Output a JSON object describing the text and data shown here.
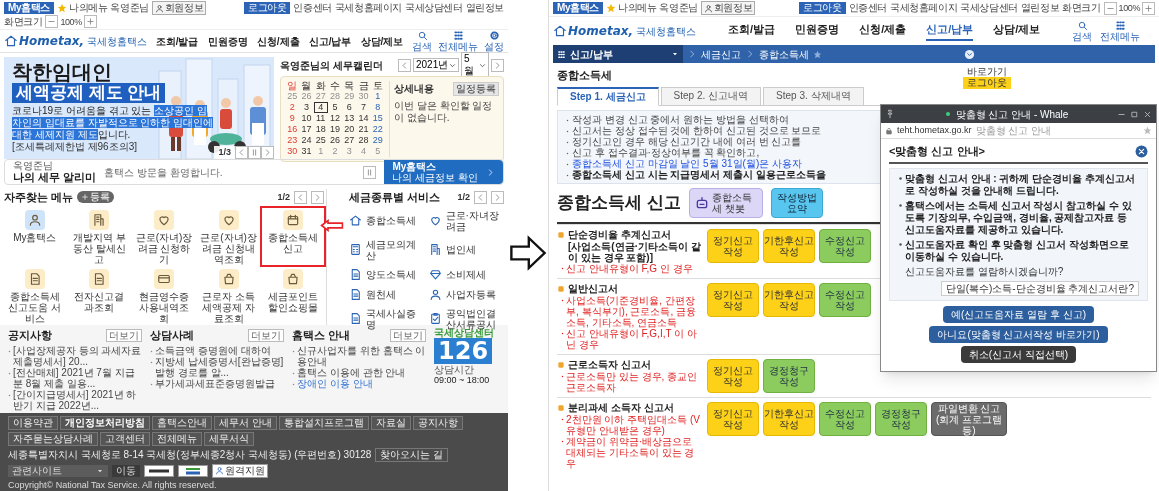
{
  "left": {
    "topbar": {
      "my": "My홈택스",
      "mymenu": "나의메뉴",
      "user": "옥영준님",
      "member": "회원정보",
      "links": [
        {
          "label": "로그아웃",
          "kind": "button"
        },
        {
          "label": "인증센터",
          "kind": "link"
        },
        {
          "label": "국세청홈페이지",
          "kind": "link"
        },
        {
          "label": "국세상담센터",
          "kind": "link"
        },
        {
          "label": "열린정보",
          "kind": "link"
        },
        {
          "label": "화면크기",
          "kind": "link"
        }
      ],
      "zoom": "100%"
    },
    "nav": {
      "logo": "Hometax,",
      "logo_sub": "국세청홈택스",
      "items": [
        "조회/발급",
        "민원증명",
        "신청/제출",
        "신고/납부",
        "상담/제보"
      ],
      "tools": [
        "검색",
        "전체메뉴",
        "설정"
      ]
    },
    "banner": {
      "title1": "착한임대인",
      "title2": "세액공제 제도 안내",
      "text_before": "코로나19로 어려움을 겪고 있는 ",
      "text_highlight": "소상공인 임차인의 임대료를 자발적으로 인하한 임대인에 대한 세제지원 제도",
      "text_after": "입니다.",
      "law": "[조세특례제한법 제96조의3]",
      "pager": "1/3"
    },
    "calendar": {
      "title": "옥영준님의 세무캘린더",
      "year": "2021년",
      "month": "5월",
      "weekdays": [
        "일",
        "월",
        "화",
        "수",
        "목",
        "금",
        "토"
      ],
      "days": [
        {
          "day": "25",
          "muted": true,
          "selected": false
        },
        {
          "day": "26",
          "muted": true,
          "selected": false
        },
        {
          "day": "27",
          "muted": true,
          "selected": false
        },
        {
          "day": "28",
          "muted": true,
          "selected": false
        },
        {
          "day": "29",
          "muted": true,
          "selected": false
        },
        {
          "day": "30",
          "muted": true,
          "selected": false
        },
        {
          "day": "1",
          "muted": false,
          "selected": false
        },
        {
          "day": "2",
          "muted": false,
          "selected": false
        },
        {
          "day": "3",
          "muted": false,
          "selected": false
        },
        {
          "day": "4",
          "muted": false,
          "selected": true
        },
        {
          "day": "5",
          "muted": false,
          "selected": false
        },
        {
          "day": "6",
          "muted": false,
          "selected": false
        },
        {
          "day": "7",
          "muted": false,
          "selected": false
        },
        {
          "day": "8",
          "muted": false,
          "selected": false
        },
        {
          "day": "9",
          "muted": false,
          "selected": false
        },
        {
          "day": "10",
          "muted": false,
          "selected": false
        },
        {
          "day": "11",
          "muted": false,
          "selected": false
        },
        {
          "day": "12",
          "muted": false,
          "selected": false
        },
        {
          "day": "13",
          "muted": false,
          "selected": false
        },
        {
          "day": "14",
          "muted": false,
          "selected": false
        },
        {
          "day": "15",
          "muted": false,
          "selected": false
        },
        {
          "day": "16",
          "muted": false,
          "selected": false
        },
        {
          "day": "17",
          "muted": false,
          "selected": false
        },
        {
          "day": "18",
          "muted": false,
          "selected": false
        },
        {
          "day": "19",
          "muted": false,
          "selected": false
        },
        {
          "day": "20",
          "muted": false,
          "selected": false
        },
        {
          "day": "21",
          "muted": false,
          "selected": false
        },
        {
          "day": "22",
          "muted": false,
          "selected": false
        },
        {
          "day": "23",
          "muted": false,
          "selected": false
        },
        {
          "day": "24",
          "muted": false,
          "selected": false
        },
        {
          "day": "25",
          "muted": false,
          "selected": false
        },
        {
          "day": "26",
          "muted": false,
          "selected": false
        },
        {
          "day": "27",
          "muted": false,
          "selected": false
        },
        {
          "day": "28",
          "muted": false,
          "selected": false
        },
        {
          "day": "29",
          "muted": false,
          "selected": false
        },
        {
          "day": "30",
          "muted": false,
          "selected": false
        },
        {
          "day": "31",
          "muted": false,
          "selected": false
        },
        {
          "day": "1",
          "muted": true,
          "selected": false
        },
        {
          "day": "2",
          "muted": true,
          "selected": false
        },
        {
          "day": "3",
          "muted": true,
          "selected": false
        },
        {
          "day": "4",
          "muted": true,
          "selected": false
        },
        {
          "day": "5",
          "muted": true,
          "selected": false
        }
      ],
      "detail_title": "상세내용",
      "add": "일정등록",
      "empty": "이번 달은 확인할 일정이 없습니다."
    },
    "alert": {
      "user": "옥영준님",
      "title": "나의 세무 알리미",
      "message": "홈택스 방문을 환영합니다.",
      "my_title": "My홈택스",
      "my_sub": "나의 세금정보 확인"
    },
    "favorites": {
      "title": "자주찾는 메뉴",
      "add": "등록",
      "page": "1/2",
      "items": [
        {
          "label": "My홈택스",
          "color": "#cfe4f8",
          "highlighted": false
        },
        {
          "label": "개발지역 부동산 탈세신고",
          "color": "#fcecc8",
          "highlighted": false
        },
        {
          "label": "근로(자녀)장려금 신청하기",
          "color": "#fcecc8",
          "highlighted": false
        },
        {
          "label": "근로(자녀)장려금 신청내역조회",
          "color": "#fcecc8",
          "highlighted": false
        },
        {
          "label": "종합소득세 신고",
          "color": "#fcecc8",
          "highlighted": true
        },
        {
          "label": "종합소득세 신고도움 서비스",
          "color": "#fcecc8",
          "highlighted": false
        },
        {
          "label": "전자신고결과조회",
          "color": "#fcecc8",
          "highlighted": false
        },
        {
          "label": "현금영수증 사용내역조회",
          "color": "#fcecc8",
          "highlighted": false
        },
        {
          "label": "근로자 소득 세액공제 자료조회",
          "color": "#fcecc8",
          "highlighted": false
        },
        {
          "label": "세금포인트 할인쇼핑몰",
          "color": "#fcecc8",
          "highlighted": false
        }
      ]
    },
    "tax_services": {
      "title": "세금종류별 서비스",
      "page": "1/2",
      "items": [
        "종합소득세",
        "근로·자녀장려금",
        "세금모의계산",
        "법인세",
        "양도소득세",
        "소비제세",
        "원천세",
        "사업자등록",
        "국세사실증명",
        "공익법인결산서류공시"
      ]
    },
    "notices": [
      {
        "title": "공지사항",
        "more": "더보기",
        "items": [
          {
            "text": "[사업장제공자 등의 과세자료 제출명세서] 20...",
            "kind": "text"
          },
          {
            "text": "[전산매체] 2021년 7월 지급분 8월 제출 일용...",
            "kind": "text"
          },
          {
            "text": "[간이지급명세서] 2021년 하반기 지급 2022년...",
            "kind": "text"
          }
        ]
      },
      {
        "title": "상담사례",
        "more": "더보기",
        "items": [
          {
            "text": "소득금액 증명원에 대하여",
            "kind": "text"
          },
          {
            "text": "지방세 납세증명서[완납증명] 발행 경로를 알...",
            "kind": "text"
          },
          {
            "text": "부가세과세표준증명원발급",
            "kind": "text"
          }
        ]
      },
      {
        "title": "홈택스 안내",
        "more": "더보기",
        "items": [
          {
            "text": "신규사업자를 위한 홈택스 이용안내",
            "kind": "text"
          },
          {
            "text": "홈택스 이용에 관한 안내",
            "kind": "text"
          },
          {
            "text": "장애인 이용 안내",
            "kind": "link"
          }
        ]
      }
    ],
    "center": {
      "logo": "국세상담센터",
      "number": "126",
      "hours_label": "상담시간",
      "hours": "09:00 ~ 18:00"
    },
    "footer": {
      "links": [
        {
          "label": "이용약관",
          "bold": false
        },
        {
          "label": "개인정보처리방침",
          "bold": true
        },
        {
          "label": "홈택스안내",
          "bold": false
        },
        {
          "label": "세무서 안내",
          "bold": false
        },
        {
          "label": "통합설치프로그램",
          "bold": false
        },
        {
          "label": "자료실",
          "bold": false
        },
        {
          "label": "공지사항",
          "bold": false
        },
        {
          "label": "자주묻는상담사례",
          "bold": false
        },
        {
          "label": "고객센터",
          "bold": false
        },
        {
          "label": "전체메뉴",
          "bold": false
        },
        {
          "label": "세무서식",
          "bold": false
        }
      ],
      "address": "세종특별자치시 국세청로 8-14 국세청(정부세종2청사 국세청동) (우편번호) 30128",
      "directions": "찾아오시는 길",
      "site_select": "관련사이트",
      "go": "이동",
      "remote": "원격지원",
      "copyright": "Copyright© National Tax Service. All rights reserved."
    }
  },
  "right": {
    "topbar": {
      "my": "My홈택스",
      "mymenu": "나의메뉴",
      "user": "옥영준님",
      "member": "회원정보",
      "links": [
        {
          "label": "로그아웃",
          "kind": "button"
        },
        {
          "label": "인증센터",
          "kind": "link"
        },
        {
          "label": "국세청홈페이지",
          "kind": "link"
        },
        {
          "label": "국세상담센터",
          "kind": "link"
        },
        {
          "label": "열린정보",
          "kind": "link"
        },
        {
          "label": "화면크기",
          "kind": "link"
        }
      ],
      "zoom": "100%"
    },
    "nav": {
      "logo": "Hometax,",
      "logo_sub": "국세청홈택스",
      "items": [
        {
          "label": "조회/발급",
          "selected": false
        },
        {
          "label": "민원증명",
          "selected": false
        },
        {
          "label": "신청/제출",
          "selected": false
        },
        {
          "label": "신고/납부",
          "selected": true
        },
        {
          "label": "상담/제보",
          "selected": false
        }
      ],
      "tools": [
        "검색",
        "전체메뉴"
      ]
    },
    "breadcrumb": {
      "menu": "신고/납부",
      "items": [
        "세금신고",
        "종합소득세"
      ]
    },
    "page_title": "종합소득세",
    "quick": {
      "label": "바로가기",
      "logout": "로그아웃"
    },
    "steps": [
      {
        "label": "Step 1. 세금신고",
        "selected": true
      },
      {
        "label": "Step 2. 신고내역",
        "selected": false
      },
      {
        "label": "Step 3. 삭제내역",
        "selected": false
      }
    ],
    "notices": [
      {
        "text": "작성과 변경 신고 중에서 원하는 방법을 선택하여",
        "kind": "normal"
      },
      {
        "text": "신고서는 정상 접수된 것에 한하여 신고된 것으로 보므로",
        "kind": "normal"
      },
      {
        "text": "정기신고인 경우 해당 신고기간 내에 여러 번 신고를",
        "kind": "normal"
      },
      {
        "text": "신고 후 접수결과·정상여부를 꼭 확인하고,",
        "kind": "normal"
      },
      {
        "text": "종합소득세 신고 마감일 날인 5월 31일(월)은 사용자",
        "kind": "blue"
      },
      {
        "text": "종합소득세 신고 시는 지급명세서 제출시 일용근로소득을",
        "kind": "bold"
      }
    ],
    "heading": "종합소득세 신고",
    "guides": [
      {
        "label": "종합소득세 챗봇",
        "kind": "chatbot"
      },
      {
        "label": "작성방법 요약",
        "kind": "plain"
      }
    ],
    "sections": [
      {
        "title": "단순경비율 추계신고서",
        "subtitle": "[사업소득(연금·기타소득이 같이 있는 경우 포함)]",
        "notes": [
          "신고 안내유형이 F,G 인 경우"
        ],
        "buttons": [
          {
            "label": "정기신고 작성",
            "kind": "filing"
          },
          {
            "label": "기한후신고 작성",
            "kind": "filing"
          },
          {
            "label": "수정신고 작성",
            "kind": "amend"
          }
        ]
      },
      {
        "title": "일반신고서",
        "notes": [
          "사업소득(기준경비율, 간편장부, 복식부기), 근로소득, 금융소득, 기타소득, 연금소득",
          "신고 안내유형이 F,G,I,T 이 아닌 경우"
        ],
        "buttons": [
          {
            "label": "정기신고 작성",
            "kind": "filing"
          },
          {
            "label": "기한후신고 작성",
            "kind": "filing"
          },
          {
            "label": "수정신고 작성",
            "kind": "amend"
          }
        ]
      },
      {
        "title": "근로소득자 신고서",
        "notes": [
          "근로소득만 있는 경우, 종교인근로소득자"
        ],
        "buttons": [
          {
            "label": "정기신고 작성",
            "kind": "filing"
          },
          {
            "label": "경정청구 작성",
            "kind": "amend"
          }
        ]
      },
      {
        "title": "분리과세 소득자 신고서",
        "notes": [
          "2천만원 이하 주택임대소득 (V 유형만 안내받은 경우)",
          "계약금이 위약금·배상금으로 대체되는 기타소득이 있는 경우"
        ],
        "buttons": [
          {
            "label": "정기신고 작성",
            "kind": "filing"
          },
          {
            "label": "기한후신고 작성",
            "kind": "filing"
          },
          {
            "label": "수정신고 작성",
            "kind": "amend"
          },
          {
            "label": "경정청구 작성",
            "kind": "amend"
          },
          {
            "label": "파일변환 신고 (회계 프로그램 등)",
            "kind": "convert"
          }
        ]
      }
    ],
    "popup": {
      "title": "맞춤형 신고 안내 - Whale",
      "url": "teht.hometax.go.kr",
      "url_title": "맞춤형 신고 안내",
      "heading": "<맞춤형 신고 안내>",
      "paragraphs": [
        "맞춤형 신고서 안내 : 귀하께 단순경비율 추계신고서로 작성하실 것을 안내해 드립니다.",
        "홈택스에서는 소득세 신고서 작성시 참고하실 수 있도록 기장의무, 수입금액, 경비율, 공제참고자료 등 신고도움자료를 제공하고 있습니다.",
        "신고도움자료 확인 후 맞춤형 신고서 작성화면으로 이동하실 수 있습니다."
      ],
      "question": "신고도움자료를 열람하시겠습니까?",
      "help": "단일(복수)소득-단순경비율 추계신고서란?",
      "buttons": [
        {
          "label": "예(신고도움자료 열람 후 신고)",
          "kind": "primary"
        },
        {
          "label": "아니요(맞춤형 신고서작성 바로가기)",
          "kind": "primary"
        },
        {
          "label": "취소(신고서 직접선택)",
          "kind": "dark"
        }
      ]
    }
  }
}
